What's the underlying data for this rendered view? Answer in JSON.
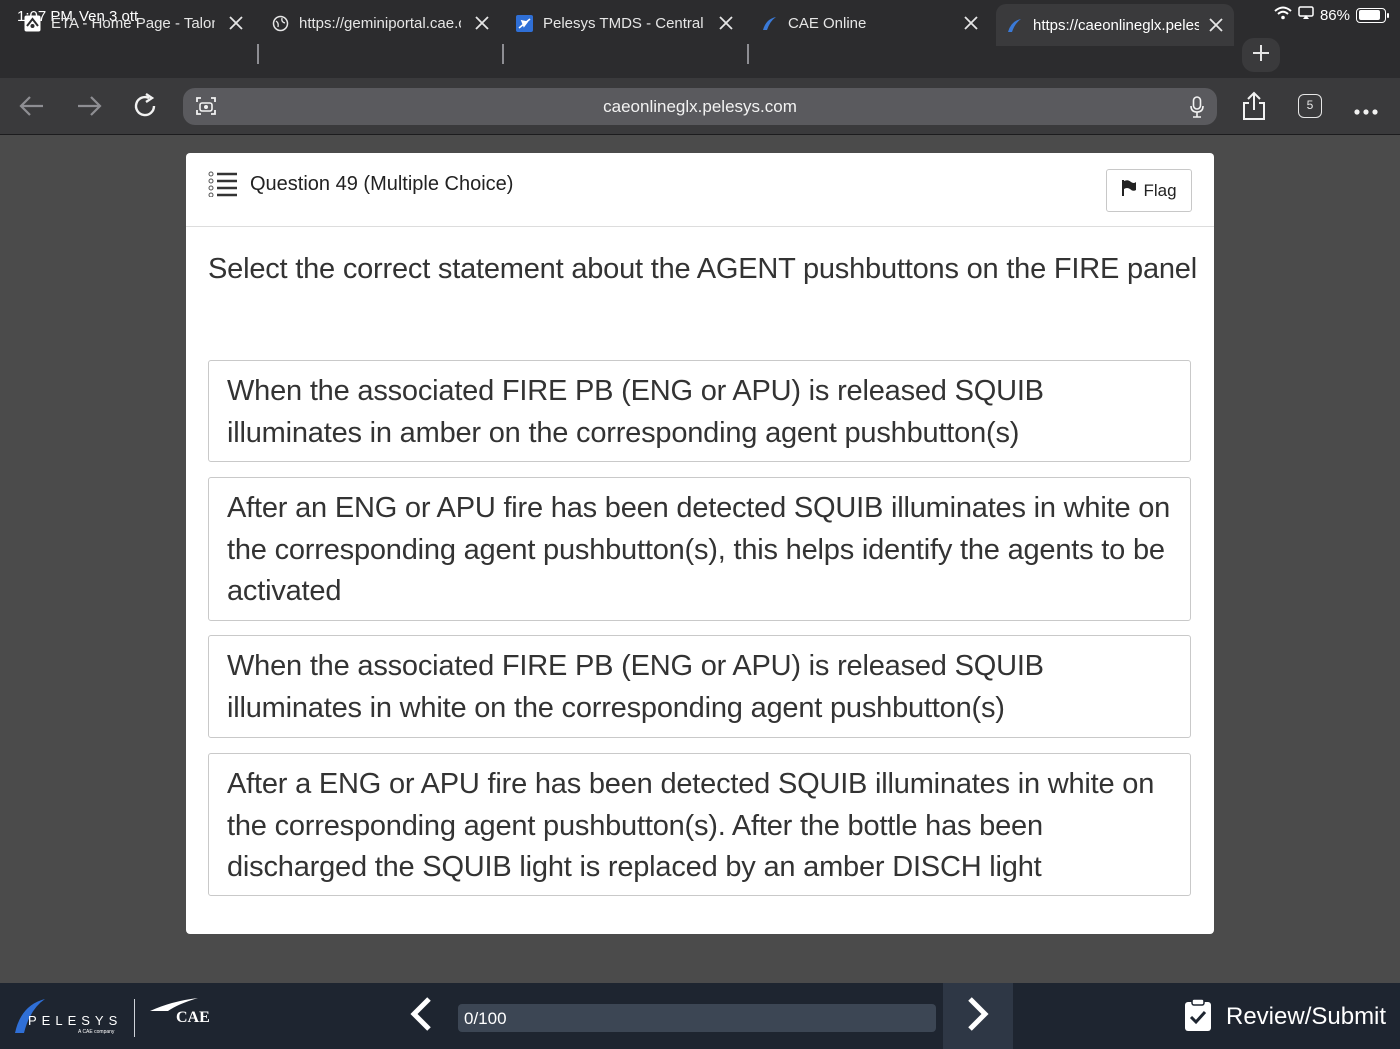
{
  "status": {
    "time": "1:07 PM",
    "date": "Ven 3 ott",
    "battery": "86%",
    "battery_level": 0.86
  },
  "tabs": [
    {
      "label": "ETA - Home Page - Talon",
      "icon": "eta-favicon"
    },
    {
      "label": "https://geminiportal.cae.com",
      "icon": "globe-icon"
    },
    {
      "label": "Pelesys TMDS - Central",
      "icon": "plane-icon"
    },
    {
      "label": "CAE Online",
      "icon": "pelesys-favicon"
    },
    {
      "label": "https://caeonlineglx.pelesys.com",
      "icon": "pelesys-favicon"
    }
  ],
  "toolbar": {
    "url": "caeonlineglx.pelesys.com",
    "tab_count": "5"
  },
  "question": {
    "title": "Question 49 (Multiple Choice)",
    "flag_label": "Flag",
    "text": "Select the correct statement about the AGENT pushbuttons on the FIRE panel",
    "options": [
      "When the associated FIRE PB (ENG or APU) is released SQUIB illuminates in amber on the corresponding agent pushbutton(s)",
      "After an ENG or APU fire has been detected SQUIB illuminates in white on the corresponding agent pushbutton(s), this helps identify the agents to be activated",
      "When the associated FIRE PB (ENG or APU) is released SQUIB illuminates in white on the corresponding agent pushbutton(s)",
      "After a ENG or APU fire has been detected SQUIB illuminates in white on the corresponding agent pushbutton(s). After the bottle has been discharged the SQUIB light is replaced by an amber DISCH light"
    ]
  },
  "footer": {
    "brand": "PELESYS",
    "brand_sub": "A CAE company",
    "brand2": "CAE",
    "progress_label": "0/100",
    "progress_fraction": 0,
    "review_label": "Review/Submit"
  }
}
